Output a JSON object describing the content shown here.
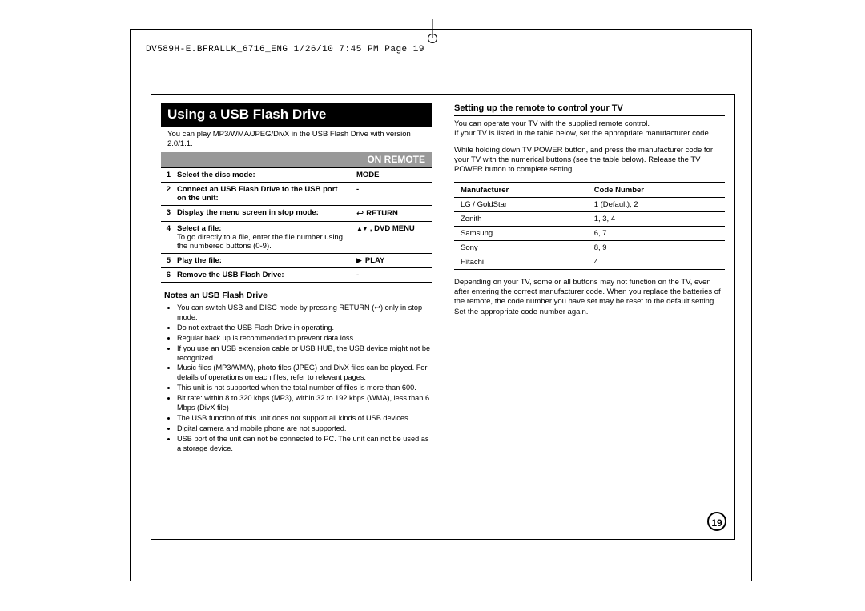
{
  "running_header": "DV589H-E.BFRALLK_6716_ENG  1/26/10  7:45 PM  Page 19",
  "page_number": "19",
  "left": {
    "title": "Using a USB Flash Drive",
    "intro": "You can play MP3/WMA/JPEG/DivX in the USB Flash Drive with version 2.0/1.1.",
    "on_remote": "ON REMOTE",
    "steps": [
      {
        "n": "1",
        "text": "Select the disc mode:",
        "sub": "",
        "remote": "MODE"
      },
      {
        "n": "2",
        "text": "Connect an USB Flash Drive to the USB port on the unit:",
        "sub": "",
        "remote": "-"
      },
      {
        "n": "3",
        "text": "Display the menu screen in stop mode:",
        "sub": "",
        "remote": "RETURN",
        "icon": "return"
      },
      {
        "n": "4",
        "text": "Select a file:",
        "sub": "To go directly to a file, enter the file number using the numbered buttons (0-9).",
        "remote": ", DVD MENU",
        "icon": "updn"
      },
      {
        "n": "5",
        "text": "Play the file:",
        "sub": "",
        "remote": "PLAY",
        "icon": "play"
      },
      {
        "n": "6",
        "text": "Remove the USB Flash Drive:",
        "sub": "",
        "remote": "-"
      }
    ],
    "notes_title": "Notes an USB Flash Drive",
    "notes": [
      "You can switch USB and DISC mode by pressing RETURN (↩) only in stop mode.",
      "Do not extract the USB Flash Drive in operating.",
      "Regular back up is recommended to prevent data loss.",
      "If you use an USB extension cable or USB HUB, the USB device might not be recognized.",
      "Music files (MP3/WMA), photo files (JPEG) and DivX files can be played. For details of operations on each files, refer to relevant pages.",
      "This unit is not supported when the total number of files is more than 600.",
      "Bit rate: within 8 to 320 kbps (MP3), within 32 to 192 kbps (WMA), less than 6 Mbps (DivX file)",
      "The USB function of this unit does not support all kinds of USB devices.",
      "Digital camera and mobile phone are not supported.",
      "USB port of the unit can not be connected to PC. The unit can not be used as a storage device."
    ]
  },
  "right": {
    "subhead": "Setting up the remote to control your TV",
    "p1": "You can operate your TV with the supplied remote control.",
    "p2": "If your TV is listed in the table below, set the appropriate manufacturer code.",
    "p3": "While holding down TV POWER button, and press the manufacturer code for your TV with the numerical buttons (see the table below). Release the TV POWER button to complete setting.",
    "table_headers": {
      "manufacturer": "Manufacturer",
      "code": "Code Number"
    },
    "codes": [
      {
        "m": "LG / GoldStar",
        "c": "1 (Default), 2"
      },
      {
        "m": "Zenith",
        "c": "1, 3, 4"
      },
      {
        "m": "Samsung",
        "c": "6, 7"
      },
      {
        "m": "Sony",
        "c": "8, 9"
      },
      {
        "m": "Hitachi",
        "c": "4"
      }
    ],
    "p4": "Depending on your TV, some or all buttons may not function on the TV, even after entering the correct manufacturer code. When you replace the batteries of the remote, the code number you have set may be reset to the default setting. Set the appropriate code number again."
  }
}
